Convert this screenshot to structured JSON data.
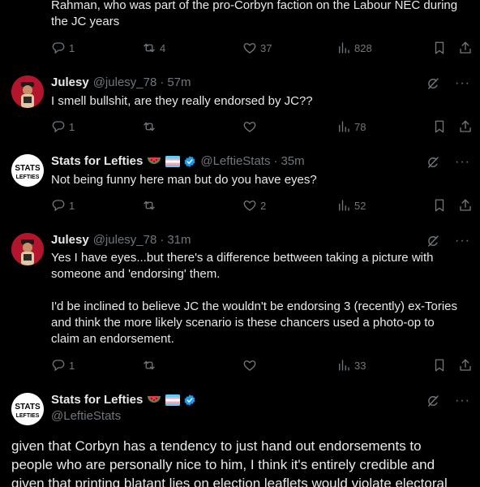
{
  "tweets": [
    {
      "text": "Rahman, who was part of the pro-Corbyn faction on the Labour NEC during\nthe JC years",
      "replies": "1",
      "retweets": "4",
      "likes": "37",
      "views": "828"
    },
    {
      "name": "Julesy",
      "handle": "@julesy_78",
      "dot": "·",
      "time": "57m",
      "text": "I smell bullshit, are they really endorsed by JC??",
      "replies": "1",
      "retweets": "",
      "likes": "",
      "views": "78"
    },
    {
      "name": "Stats for Lefties",
      "handle": "@LeftieStats",
      "dot": "·",
      "time": "35m",
      "text": "Not being funny here man but do you have eyes?",
      "replies": "1",
      "retweets": "",
      "likes": "2",
      "views": "52"
    },
    {
      "name": "Julesy",
      "handle": "@julesy_78",
      "dot": "·",
      "time": "31m",
      "text": "Yes I have eyes...but there's a difference bettween taking a picture with\nsomeone and 'endorsing' them.\n\nI'd be inclined to believe JC the wouldn't be endorsing 3 (recently) ex-Tories\nand think the more likely scenario is these chancers used a photo-op to\nclaim an endorsement.",
      "replies": "1",
      "retweets": "",
      "likes": "",
      "views": "33"
    },
    {
      "name": "Stats for Lefties",
      "handle": "@LeftieStats",
      "text": "given that Corbyn has a tendency to just hand out endorsements to\npeople who are personally nice to him, I think it's entirely credible and\ngiven that printing blatant lies on election leaflets would violate electoral"
    }
  ],
  "avatars": {
    "stats_label_top": "STATS",
    "stats_label_bottom": "LEFTIES"
  },
  "more_label": "···",
  "colors": {
    "background": "#000000",
    "text": "#e7e9ea",
    "muted": "#71767b",
    "verified": "#1d9bf0",
    "julesy_avatar": "#b3162c"
  }
}
